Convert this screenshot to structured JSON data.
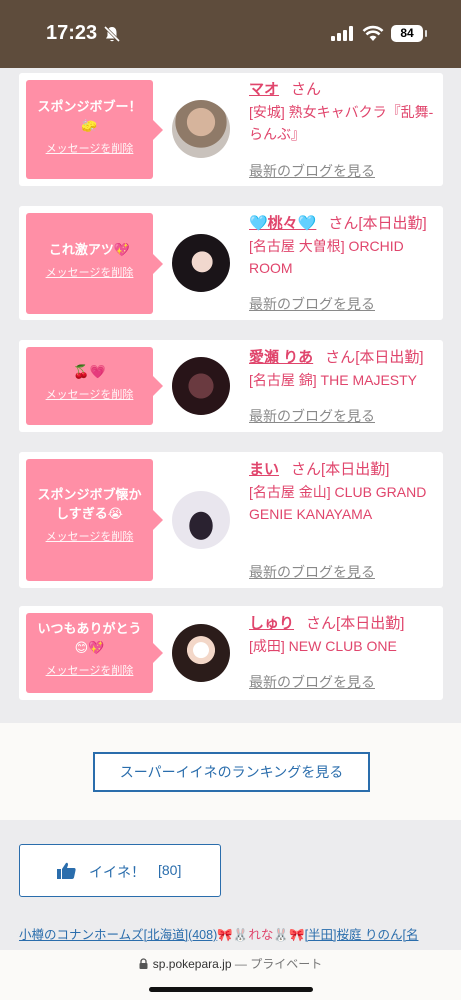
{
  "status_bar": {
    "time": "17:23",
    "battery": "84"
  },
  "list": [
    {
      "message": "スポンジボブー！🧽",
      "delete_label": "メッセージを削除",
      "name": "マオ",
      "honorific": "さん",
      "status": "",
      "shop": "[安城] 熟女キャバクラ『乱舞-らんぶ』",
      "blog_label": "最新のブログを見る"
    },
    {
      "message": "これ激アツ💖",
      "delete_label": "メッセージを削除",
      "name": "🩵桃々🩵",
      "honorific": "さん",
      "status": "[本日出勤]",
      "shop": "[名古屋 大曽根] ORCHID ROOM",
      "blog_label": "最新のブログを見る"
    },
    {
      "message": "🍒💗",
      "delete_label": "メッセージを削除",
      "name": "愛瀬 りあ",
      "honorific": "さん",
      "status": "[本日出勤]",
      "shop": "[名古屋 錦] THE MAJESTY",
      "blog_label": "最新のブログを見る"
    },
    {
      "message": "スポンジボブ懐かしすぎる😭",
      "delete_label": "メッセージを削除",
      "name": "まい",
      "honorific": "さん",
      "status": "[本日出勤]",
      "shop": "[名古屋 金山] CLUB GRAND GENIE KANAYAMA",
      "blog_label": "最新のブログを見る"
    },
    {
      "message": "いつもありがとう😊💖",
      "delete_label": "メッセージを削除",
      "name": "しゅり",
      "honorific": "さん",
      "status": "[本日出勤]",
      "shop": "[成田] NEW CLUB ONE",
      "blog_label": "最新のブログを見る"
    }
  ],
  "ranking_button": "スーパーイイネのランキングを見る",
  "like_button": {
    "label": "イイネ！",
    "count": "[80]"
  },
  "bottom_links": {
    "link1": "小樽のコナンホームズ[北海道](408)",
    "deco1": "🎀🐰",
    "name1": "れな",
    "deco2": "🐰🎀",
    "link2": "[半田]桜庭 りのん[名"
  },
  "browser": {
    "url": "sp.pokepara.jp",
    "mode": "— プライベート"
  },
  "colors": {
    "accent_pink": "#e0456c",
    "bubble_pink": "#ff8fa6",
    "link_blue": "#2a6dac",
    "status_bar_brown": "#5e4c3c"
  }
}
